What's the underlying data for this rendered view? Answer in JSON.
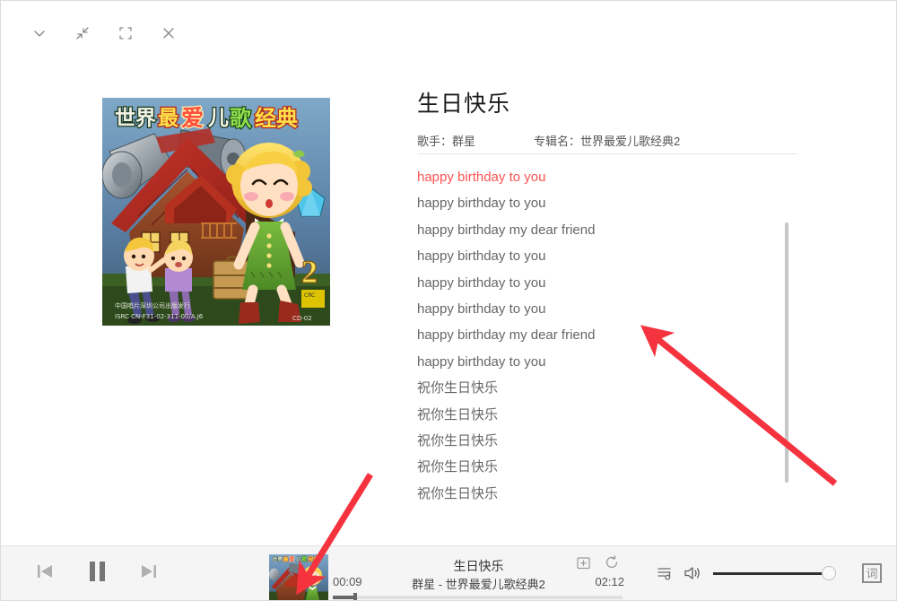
{
  "window": {
    "titlebar_buttons": [
      {
        "name": "collapse-down-button",
        "icon": "chevron-down-icon",
        "label": ""
      },
      {
        "name": "restore-down-button",
        "icon": "shrink-arrows-icon",
        "label": ""
      },
      {
        "name": "fullscreen-button",
        "icon": "fullscreen-frame-icon",
        "label": ""
      },
      {
        "name": "close-button",
        "icon": "close-icon",
        "label": ""
      }
    ]
  },
  "song": {
    "title": "生日快乐",
    "artist_label": "歌手：",
    "artist": "群星",
    "album_label": "专辑名：",
    "album": "世界最爱儿歌经典2"
  },
  "cover": {
    "heading": "世界最爱儿歌经典",
    "volume_number": "2",
    "publisher_line": "中国唱片深圳公司出版发行",
    "isrc_line": "ISRC CN-F31-02-311-00/A.J6",
    "disc_code": "CD-02"
  },
  "lyrics": {
    "active_index": 0,
    "lines": [
      "happy birthday to you",
      "happy birthday to you",
      "happy birthday my dear friend",
      "happy birthday to you",
      "happy birthday to you",
      "happy birthday to you",
      "happy birthday my dear friend",
      "happy birthday to you",
      "祝你生日快乐",
      "祝你生日快乐",
      "祝你生日快乐",
      "祝你生日快乐",
      "祝你生日快乐"
    ]
  },
  "player": {
    "prev_label": "",
    "pause_label": "",
    "next_label": "",
    "now_playing_title": "生日快乐",
    "now_playing_subtitle": "群星 - 世界最爱儿歌经典2",
    "current_time": "00:09",
    "duration": "02:12",
    "progress_percent": 7,
    "volume_percent": 100,
    "add_to_list_icon": "folder-plus-icon",
    "repeat_icon": "repeat-loop-icon",
    "playlist_icon": "playlist-icon",
    "volume_icon": "speaker-icon",
    "lyric_toggle_label": "词"
  },
  "colors": {
    "active_lyric": "#ff5252",
    "lyric": "#666666",
    "annotation_arrow": "#f5333f",
    "player_bg": "#f5f5f5"
  }
}
